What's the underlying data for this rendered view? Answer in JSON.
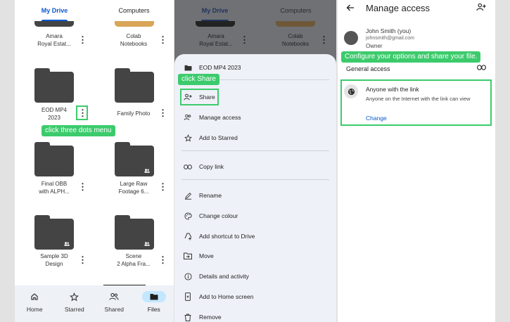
{
  "p1": {
    "tabs": [
      "My Drive",
      "Computers"
    ],
    "tiles": [
      {
        "name": "Amara\nRoyal Estat..."
      },
      {
        "name": "Colab\nNotebooks"
      },
      {
        "name": "EOD MP4\n2023"
      },
      {
        "name": "Family Photo"
      },
      {
        "name": "Final OBB\nwith ALPH..."
      },
      {
        "name": "Large Raw\nFootage 6..."
      },
      {
        "name": "Sample 3D\nDesign"
      },
      {
        "name": "Scene\n2 Alpha Fra..."
      }
    ],
    "callout": "click three dots menu",
    "nav": {
      "home": "Home",
      "starred": "Starred",
      "shared": "Shared",
      "files": "Files"
    }
  },
  "p2": {
    "tabs": [
      "My Drive",
      "Computers"
    ],
    "tiles": [
      {
        "name": "Amara\nRoyal Estat..."
      },
      {
        "name": "Colab\nNotebooks"
      }
    ],
    "sheet_title": "EOD MP4 2023",
    "callout": "click Share",
    "items": {
      "share": "Share",
      "manage": "Manage access",
      "starred": "Add to Starred",
      "copy": "Copy link",
      "rename": "Rename",
      "colour": "Change colour",
      "shortcut": "Add shortcut to Drive",
      "move": "Move",
      "details": "Details and activity",
      "homescreen": "Add to Home screen",
      "remove": "Remove"
    }
  },
  "p3": {
    "title": "Manage access",
    "owner_name": "John Smith (you)",
    "owner_email": "johnsmith@gmail.com",
    "owner_role": "Owner",
    "callout": "Configure your options and share your file.",
    "general_access": "General access",
    "access_title": "Anyone with the link",
    "access_desc": "Anyone on the Internet with the link can view",
    "change": "Change"
  },
  "colors": {
    "accent": "#0b57d0",
    "callout": "#3ccb6c",
    "folder": "#444444"
  }
}
